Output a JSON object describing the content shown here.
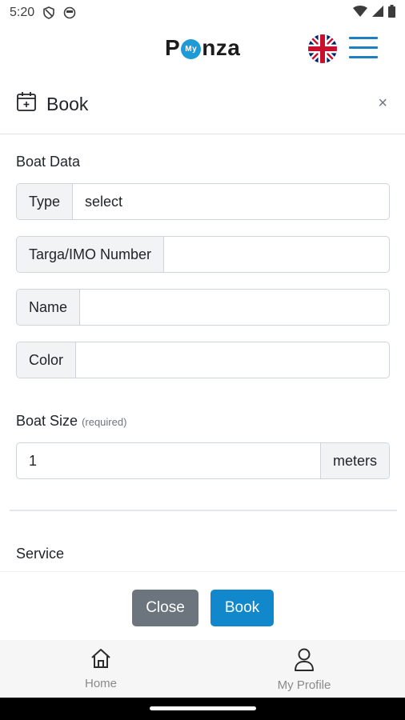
{
  "status_bar": {
    "time": "5:20"
  },
  "header": {
    "logo_before": "P",
    "logo_badge": "My",
    "logo_after": "nza",
    "flag": "uk-flag",
    "menu_icon": "hamburger-icon"
  },
  "modal": {
    "title": "Book",
    "close_symbol": "×"
  },
  "boat_data": {
    "section_title": "Boat Data",
    "type_label": "Type",
    "type_value": "select",
    "targa_label": "Targa/IMO Number",
    "targa_value": "",
    "name_label": "Name",
    "name_value": "",
    "color_label": "Color",
    "color_value": ""
  },
  "boat_size": {
    "title": "Boat Size",
    "required_note": "(required)",
    "value": "1",
    "unit": "meters"
  },
  "service": {
    "title": "Service"
  },
  "footer": {
    "close_label": "Close",
    "book_label": "Book"
  },
  "bottom_nav": {
    "home_label": "Home",
    "profile_label": "My Profile"
  },
  "colors": {
    "primary": "#1188cc",
    "secondary": "#6c757d",
    "accent": "#1e9bd7"
  }
}
